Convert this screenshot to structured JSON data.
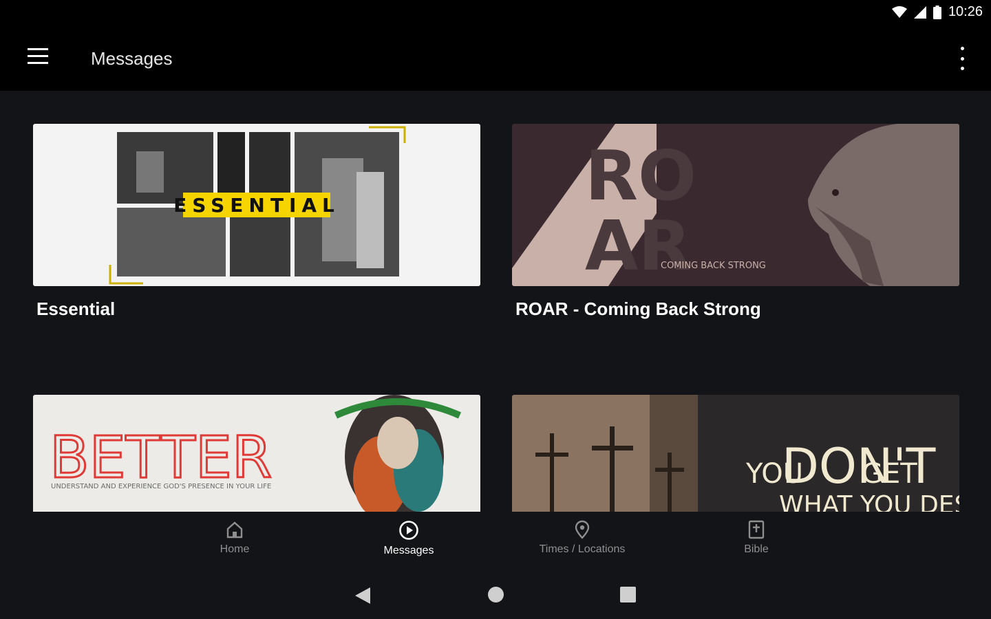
{
  "status": {
    "time": "10:26"
  },
  "appbar": {
    "title": "Messages"
  },
  "series": [
    {
      "label": "Essential",
      "art_text": "ESSENTIAL"
    },
    {
      "label": "ROAR - Coming Back Strong",
      "art_ro": "RO",
      "art_ar": "AR",
      "art_sub": "COMING BACK STRONG"
    },
    {
      "label": "",
      "art_text": "BETTER",
      "art_sub": "UNDERSTAND AND EXPERIENCE GOD'S PRESENCE IN YOUR LIFE"
    },
    {
      "label": "",
      "art_you": "YOU",
      "art_dont": "DON'T",
      "art_get": "GET",
      "art_sub": "WHAT YOU DESERVE"
    }
  ],
  "bottom_nav": [
    {
      "label": "Home",
      "icon": "home-icon",
      "active": false
    },
    {
      "label": "Messages",
      "icon": "play-circle-icon",
      "active": true
    },
    {
      "label": "Times / Locations",
      "icon": "location-pin-icon",
      "active": false
    },
    {
      "label": "Bible",
      "icon": "bible-icon",
      "active": false
    }
  ],
  "colors": {
    "accent_yellow": "#f5d400",
    "roar_bg": "#3a2a30",
    "roar_triangle": "#c9b0a8",
    "better_red": "#e03a36"
  }
}
